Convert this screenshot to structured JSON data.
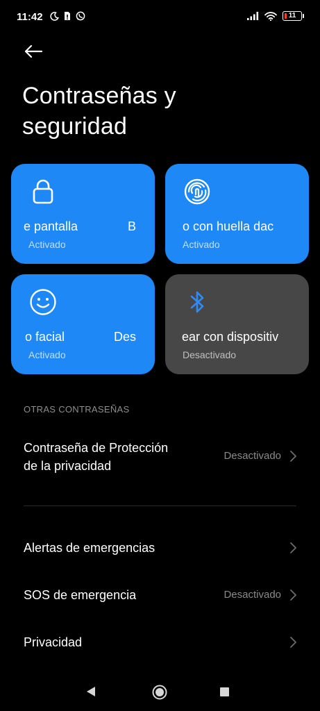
{
  "status_bar": {
    "time": "11:42",
    "battery_level": "11",
    "icons_left": [
      "moon-icon",
      "sim-alert-icon",
      "whatsapp-icon"
    ],
    "icons_right": [
      "signal-icon",
      "wifi-icon",
      "battery-icon"
    ]
  },
  "header": {
    "title_line1": "Contraseñas y",
    "title_line2": "seguridad",
    "back_icon": "back-arrow-icon"
  },
  "tiles": [
    {
      "title_visible": "e pantalla",
      "title_tail": "B",
      "status": "Activado",
      "icon": "lock-icon",
      "state": "on"
    },
    {
      "title_visible": "o con huella dac",
      "status": "Activado",
      "icon": "fingerprint-icon",
      "state": "on"
    },
    {
      "title_visible": "o facial",
      "title_tail": "Des",
      "status": "Activado",
      "icon": "face-icon",
      "state": "on"
    },
    {
      "title_visible": "ear con dispositiv",
      "status": "Desactivado",
      "icon": "bluetooth-icon",
      "state": "off"
    }
  ],
  "section": {
    "header": "OTRAS CONTRASEÑAS"
  },
  "items": [
    {
      "label_line1": "Contraseña de Protección",
      "label_line2": "de la privacidad",
      "value": "Desactivado"
    },
    {
      "label": "Alertas de emergencias",
      "value": ""
    },
    {
      "label": "SOS de emergencia",
      "value": "Desactivado"
    },
    {
      "label": "Privacidad",
      "value": ""
    }
  ],
  "colors": {
    "background": "#000000",
    "tile_active": "#1e88f7",
    "tile_inactive": "#474747",
    "secondary_text": "#8b8b8b",
    "accent": "#1e88f7"
  },
  "nav_bar": {
    "icons": [
      "nav-back-icon",
      "nav-home-icon",
      "nav-recents-icon"
    ]
  }
}
